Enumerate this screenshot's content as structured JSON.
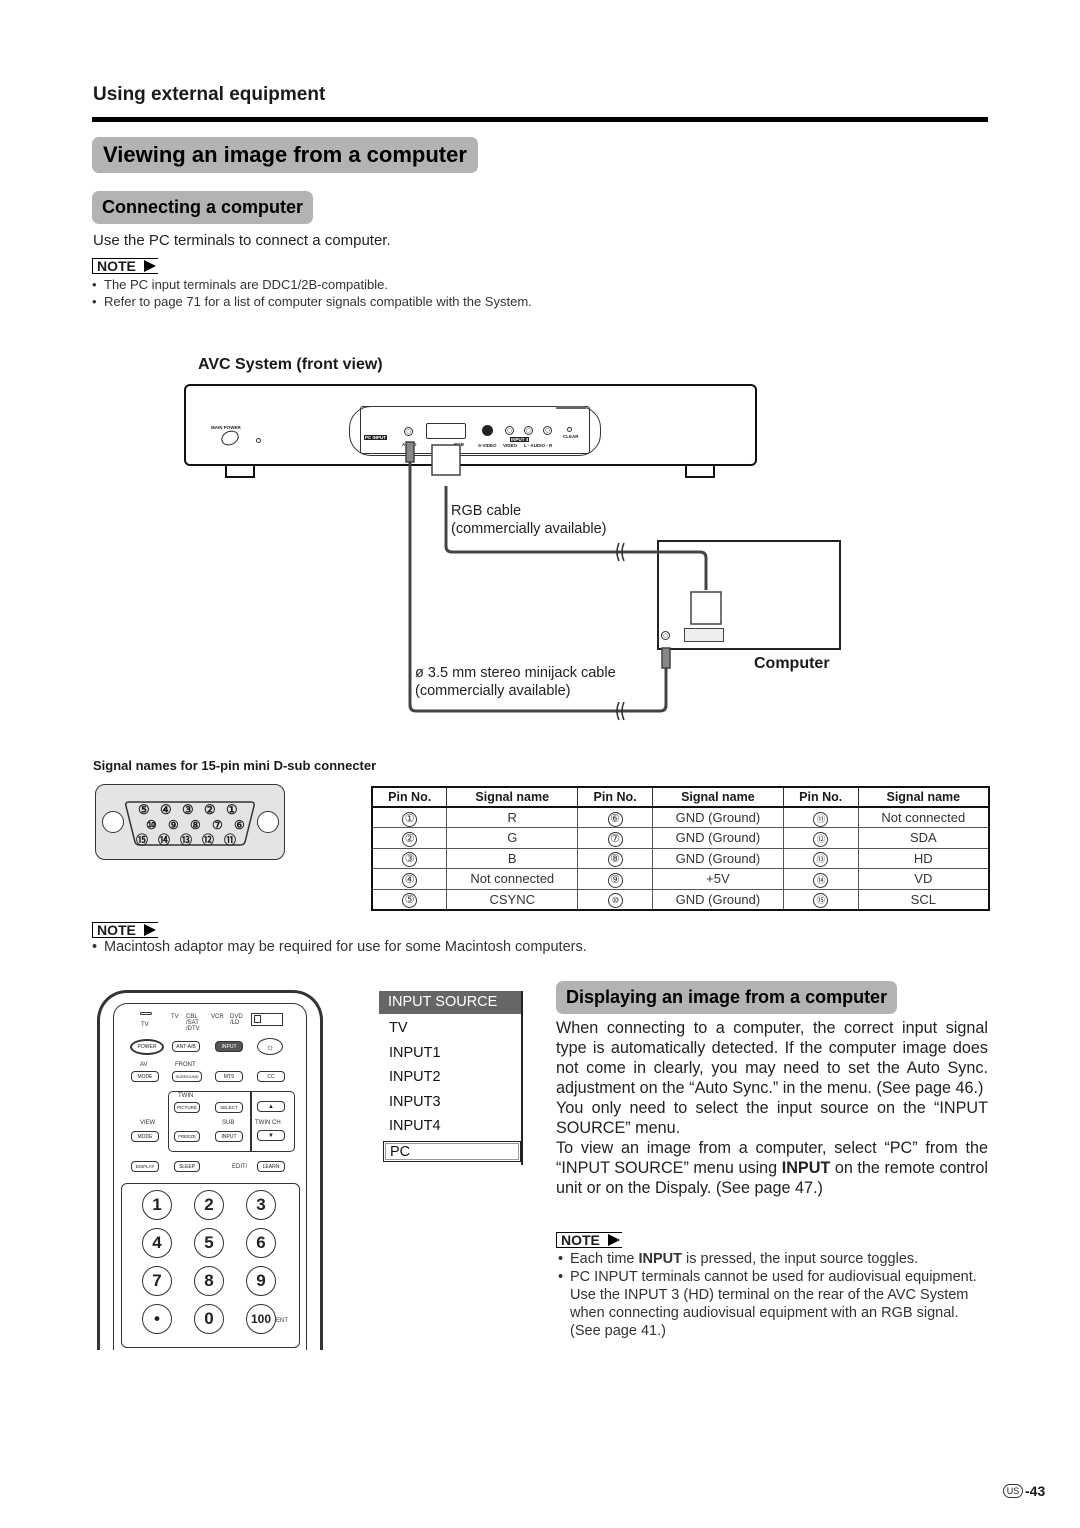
{
  "header": {
    "section": "Using external equipment"
  },
  "title": "Viewing an image from a computer",
  "connecting": {
    "heading": "Connecting a computer",
    "intro": "Use the PC terminals to connect a computer.",
    "note_label": "NOTE",
    "notes": [
      "The PC input terminals are DDC1/2B-compatible.",
      "Refer to page 71 for a list of computer signals compatible with the System."
    ]
  },
  "diagram": {
    "title": "AVC System (front view)",
    "device_labels": {
      "main_power": "MAIN POWER",
      "pc_input": "PC INPUT",
      "audio": "AUDIO",
      "rgb": "RGB",
      "svideo": "S-VIDEO",
      "video": "VIDEO",
      "l_audio_r": "L - AUDIO - R",
      "input4": "INPUT 4",
      "clear": "CLEAR"
    },
    "rgb_cable": [
      "RGB cable",
      "(commercially available)"
    ],
    "audio_cable": [
      "ø 3.5 mm stereo minijack cable",
      "(commercially available)"
    ],
    "computer_label": "Computer"
  },
  "signals": {
    "title": "Signal names for 15-pin mini D-sub connecter",
    "connector_rows": [
      [
        "⑤",
        "④",
        "③",
        "②",
        "①"
      ],
      [
        "⑩",
        "⑨",
        "⑧",
        "⑦",
        "⑥"
      ],
      [
        "⑮",
        "⑭",
        "⑬",
        "⑫",
        "⑪"
      ]
    ],
    "columns": [
      "Pin No.",
      "Signal name",
      "Pin No.",
      "Signal name",
      "Pin No.",
      "Signal name"
    ],
    "rows": [
      [
        "1",
        "R",
        "6",
        "GND (Ground)",
        "11",
        "Not connected"
      ],
      [
        "2",
        "G",
        "7",
        "GND (Ground)",
        "12",
        "SDA"
      ],
      [
        "3",
        "B",
        "8",
        "GND (Ground)",
        "13",
        "HD"
      ],
      [
        "4",
        "Not connected",
        "9",
        "+5V",
        "14",
        "VD"
      ],
      [
        "5",
        "CSYNC",
        "10",
        "GND (Ground)",
        "15",
        "SCL"
      ]
    ],
    "note_label": "NOTE",
    "note": "Macintosh adaptor may be required for use for some Macintosh computers."
  },
  "remote": {
    "mode_labels": [
      "TV",
      "CBL /SAT /DTV",
      "VCR",
      "DVD /LD"
    ],
    "tv": "TV",
    "power": "POWER",
    "ant": "ANT-A/B",
    "input": "INPUT",
    "av": "AV",
    "mode": "MODE",
    "front": "FRONT",
    "surround": "SURROUND",
    "mts": "MTS",
    "cc": "CC",
    "twin": "TWIN",
    "picture": "PICTURE",
    "select": "SELECT",
    "view": "VIEW",
    "sub": "SUB",
    "twin_ch": "TWIN CH",
    "freeze": "FREEZE",
    "display": "DISPLAY",
    "sleep": "SLEEP",
    "edit": "EDIT/",
    "learn": "LEARN",
    "numbers": [
      "1",
      "2",
      "3",
      "4",
      "5",
      "6",
      "7",
      "8",
      "9",
      "•",
      "0",
      "100"
    ],
    "ent": "ENT"
  },
  "menu": {
    "title": "INPUT SOURCE",
    "items": [
      "TV",
      "INPUT1",
      "INPUT2",
      "INPUT3",
      "INPUT4",
      "PC"
    ],
    "selected": "PC"
  },
  "displaying": {
    "heading": "Displaying an image from a computer",
    "para1": "When connecting to a computer, the correct input signal type is automatically detected.  If the computer image does not come in clearly, you may need to set the Auto Sync. adjustment on the “Auto Sync.” in the menu. (See page 46.)",
    "para2": "You only need to select the input source on the “INPUT SOURCE” menu.",
    "para3_a": "To view an image from a computer, select “PC” from the “INPUT SOURCE” menu using ",
    "para3_bold": "INPUT",
    "para3_b": " on the remote control unit or on the Dispaly. (See page 47.)",
    "note_label": "NOTE",
    "note1_a": "Each time ",
    "note1_bold": "INPUT",
    "note1_b": " is pressed, the input source toggles.",
    "note2": "PC INPUT terminals cannot be used for audiovisual equipment. Use the INPUT 3 (HD) terminal on the rear of the AVC System when connecting audiovisual equipment with an RGB signal. (See page 41.)"
  },
  "footer": {
    "region": "US",
    "page": "-43"
  }
}
